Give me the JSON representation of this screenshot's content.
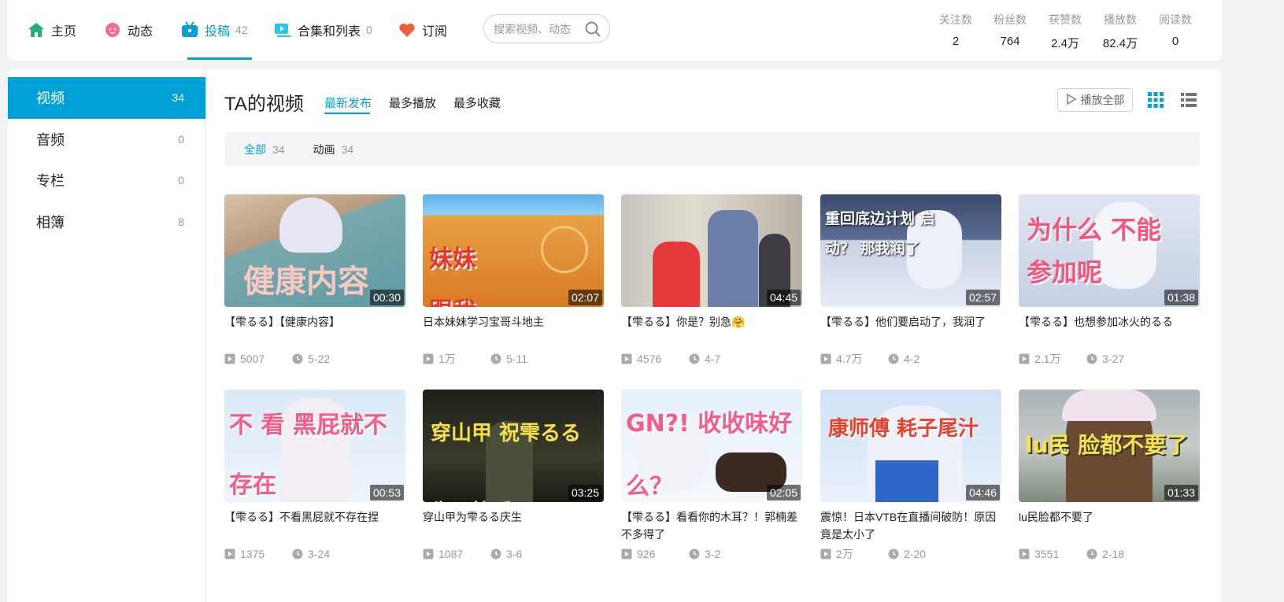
{
  "nav": {
    "home": "主页",
    "dynamic": "动态",
    "submit": "投稿",
    "submit_count": "42",
    "collection": "合集和列表",
    "collection_count": "0",
    "subscribe": "订阅",
    "search_placeholder": "搜索视频、动态"
  },
  "stats": [
    {
      "label": "关注数",
      "value": "2"
    },
    {
      "label": "粉丝数",
      "value": "764"
    },
    {
      "label": "获赞数",
      "value": "2.4万"
    },
    {
      "label": "播放数",
      "value": "82.4万"
    },
    {
      "label": "阅读数",
      "value": "0"
    }
  ],
  "sidebar": [
    {
      "label": "视频",
      "count": "34"
    },
    {
      "label": "音频",
      "count": "0"
    },
    {
      "label": "专栏",
      "count": "0"
    },
    {
      "label": "相簿",
      "count": "8"
    }
  ],
  "content": {
    "title": "TA的视频",
    "tabs": [
      "最新发布",
      "最多播放",
      "最多收藏"
    ],
    "play_all": "播放全部",
    "filters": [
      {
        "label": "全部",
        "count": "34"
      },
      {
        "label": "动画",
        "count": "34"
      }
    ]
  },
  "colors": {
    "accent": "#00a1d6"
  },
  "videos": [
    {
      "title": "【雫るる】【健康内容】",
      "duration": "00:30",
      "plays": "5007",
      "date": "5-22",
      "thumb_text": "健康内容"
    },
    {
      "title": "日本妹妹学习宝哥斗地主",
      "duration": "02:07",
      "plays": "1万",
      "date": "5-11",
      "thumb_text": "妹妹 跟我学着"
    },
    {
      "title": "【雫るる】你是？别急🤗",
      "duration": "04:45",
      "plays": "4576",
      "date": "4-7",
      "thumb_text": ""
    },
    {
      "title": "【雫るる】他们要启动了，我润了",
      "duration": "02:57",
      "plays": "4.7万",
      "date": "4-2",
      "thumb_text": "重回底边计划 启动？ 那我润了"
    },
    {
      "title": "【雫るる】也想参加冰火的るる",
      "duration": "01:38",
      "plays": "2.1万",
      "date": "3-27",
      "thumb_text": "为什么 不能参加呢"
    },
    {
      "title": "【雫るる】不看黑屁就不存在捏",
      "duration": "00:53",
      "plays": "1375",
      "date": "3-24",
      "thumb_text": "不 看 黑屁就不存在"
    },
    {
      "title": "穿山甲为雫るる庆生",
      "duration": "03:25",
      "plays": "1087",
      "date": "3-6",
      "thumb_text": "穿山甲 祝雫るる生日快乐"
    },
    {
      "title": "【雫るる】看看你的木耳？！郭楠差不多得了",
      "duration": "02:05",
      "plays": "926",
      "date": "3-2",
      "thumb_text": "GN?! 收收味好么？"
    },
    {
      "title": "震惊！日本VTB在直播间破防！原因竟是太小了",
      "duration": "04:46",
      "plays": "2万",
      "date": "2-20",
      "thumb_text": "康师傅 耗子尾汁"
    },
    {
      "title": "lu民脸都不要了",
      "duration": "01:33",
      "plays": "3551",
      "date": "2-18",
      "thumb_text": "lu民 脸都不要了"
    }
  ]
}
